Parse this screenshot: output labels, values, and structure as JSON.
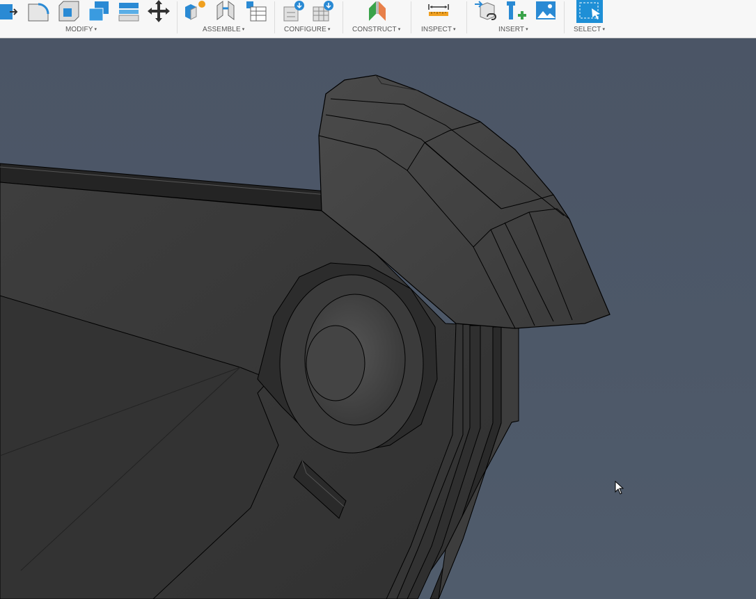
{
  "toolbar": {
    "groups": [
      {
        "id": "modify",
        "label": "MODIFY"
      },
      {
        "id": "assemble",
        "label": "ASSEMBLE"
      },
      {
        "id": "configure",
        "label": "CONFIGURE"
      },
      {
        "id": "construct",
        "label": "CONSTRUCT"
      },
      {
        "id": "inspect",
        "label": "INSPECT"
      },
      {
        "id": "insert",
        "label": "INSERT"
      },
      {
        "id": "select",
        "label": "SELECT"
      }
    ],
    "dropdown_caret": "▾",
    "icons": {
      "modify": [
        "press-pull-icon",
        "fillet-icon",
        "shell-icon",
        "combine-icon",
        "offset-face-icon",
        "move-icon"
      ],
      "assemble": [
        "new-component-icon",
        "joint-icon",
        "configure-table-icon"
      ],
      "configure": [
        "configure-parameter-icon",
        "configure-table-icon"
      ],
      "construct": [
        "plane-icon"
      ],
      "inspect": [
        "measure-icon"
      ],
      "insert": [
        "insert-derive-icon",
        "insert-mcmaster-icon",
        "insert-canvas-icon"
      ],
      "select": [
        "select-window-icon"
      ]
    },
    "colors": {
      "accent": "#1e8fd6",
      "orange": "#f0a020",
      "green": "#3aa34a"
    }
  },
  "viewport": {
    "background": "#4b5566",
    "model_color": "#3c3c3c"
  }
}
